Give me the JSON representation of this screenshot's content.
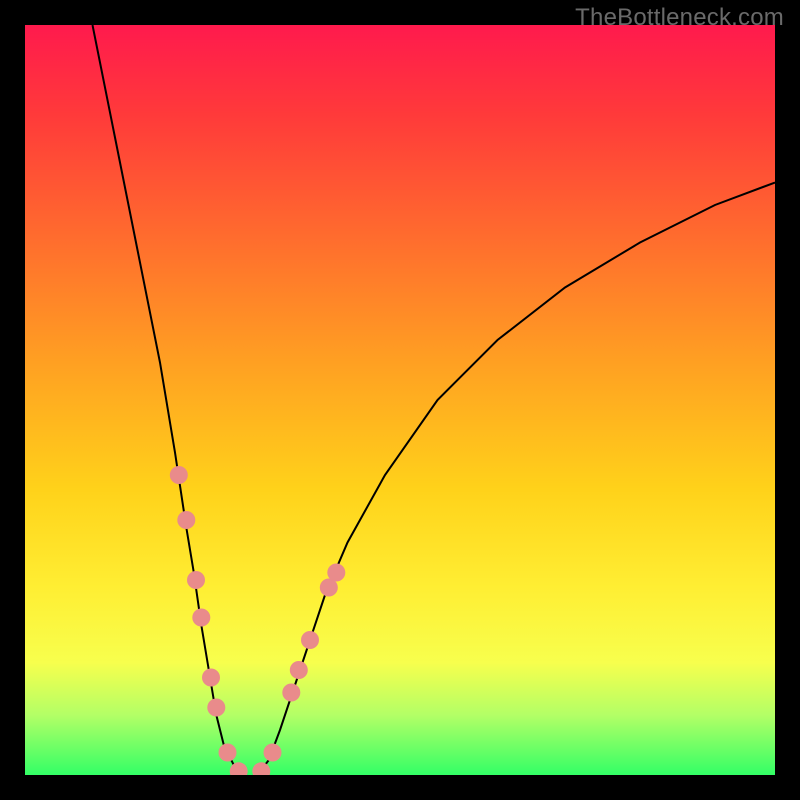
{
  "watermark": "TheBottleneck.com",
  "chart_data": {
    "type": "line",
    "title": "",
    "xlabel": "",
    "ylabel": "",
    "xlim": [
      0,
      100
    ],
    "ylim": [
      0,
      100
    ],
    "series": [
      {
        "name": "left-curve",
        "points": [
          {
            "x": 9,
            "y": 100
          },
          {
            "x": 12,
            "y": 85
          },
          {
            "x": 15,
            "y": 70
          },
          {
            "x": 18,
            "y": 55
          },
          {
            "x": 20,
            "y": 43
          },
          {
            "x": 21.5,
            "y": 33
          },
          {
            "x": 22.5,
            "y": 27
          },
          {
            "x": 23.5,
            "y": 20
          },
          {
            "x": 24.5,
            "y": 14
          },
          {
            "x": 25.5,
            "y": 8
          },
          {
            "x": 26.5,
            "y": 4
          },
          {
            "x": 28,
            "y": 1
          },
          {
            "x": 29,
            "y": 0
          }
        ]
      },
      {
        "name": "right-curve",
        "points": [
          {
            "x": 31,
            "y": 0
          },
          {
            "x": 32.5,
            "y": 2
          },
          {
            "x": 34,
            "y": 6
          },
          {
            "x": 36,
            "y": 12
          },
          {
            "x": 38,
            "y": 18
          },
          {
            "x": 40,
            "y": 24
          },
          {
            "x": 43,
            "y": 31
          },
          {
            "x": 48,
            "y": 40
          },
          {
            "x": 55,
            "y": 50
          },
          {
            "x": 63,
            "y": 58
          },
          {
            "x": 72,
            "y": 65
          },
          {
            "x": 82,
            "y": 71
          },
          {
            "x": 92,
            "y": 76
          },
          {
            "x": 100,
            "y": 79
          }
        ]
      }
    ],
    "highlight_points": [
      {
        "series": "left-curve",
        "x": 20.5,
        "y": 40
      },
      {
        "series": "left-curve",
        "x": 21.5,
        "y": 34
      },
      {
        "series": "left-curve",
        "x": 22.8,
        "y": 26
      },
      {
        "series": "left-curve",
        "x": 23.5,
        "y": 21
      },
      {
        "series": "left-curve",
        "x": 24.8,
        "y": 13
      },
      {
        "series": "left-curve",
        "x": 25.5,
        "y": 9
      },
      {
        "series": "left-curve",
        "x": 27.0,
        "y": 3
      },
      {
        "series": "left-curve",
        "x": 28.5,
        "y": 0.5
      },
      {
        "series": "right-curve",
        "x": 31.5,
        "y": 0.5
      },
      {
        "series": "right-curve",
        "x": 33.0,
        "y": 3
      },
      {
        "series": "right-curve",
        "x": 35.5,
        "y": 11
      },
      {
        "series": "right-curve",
        "x": 36.5,
        "y": 14
      },
      {
        "series": "right-curve",
        "x": 38.0,
        "y": 18
      },
      {
        "series": "right-curve",
        "x": 40.5,
        "y": 25
      },
      {
        "series": "right-curve",
        "x": 41.5,
        "y": 27
      }
    ],
    "colors": {
      "curve": "#000000",
      "dots": "#e98b8b",
      "gradient_top": "#ff1a4d",
      "gradient_bottom": "#33ff66"
    }
  }
}
